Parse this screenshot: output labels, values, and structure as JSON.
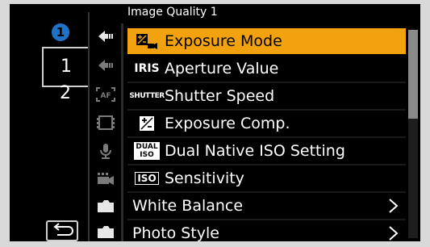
{
  "header": {
    "title": "Image Quality 1"
  },
  "left": {
    "mode_badge": "1",
    "tab1": "1",
    "tab2": "2"
  },
  "icons": [
    "camera-settings-icon",
    "camera-settings-icon-2",
    "af-icon",
    "film-icon",
    "microphone-icon",
    "video-camera-icon",
    "camera-body-icon",
    "camera-body-icon-2"
  ],
  "menu": {
    "items": [
      {
        "icon_text": "",
        "label": "Exposure Mode",
        "selected": true
      },
      {
        "icon_text": "IRIS",
        "label": "Aperture Value"
      },
      {
        "icon_text": "SHUTTER",
        "label": "Shutter Speed"
      },
      {
        "icon_text": "",
        "label": "Exposure Comp."
      },
      {
        "icon_text": "DUAL ISO",
        "label": "Dual Native ISO Setting"
      },
      {
        "icon_text": "ISO",
        "label": "Sensitivity"
      },
      {
        "icon_text": "",
        "label": "White Balance"
      },
      {
        "icon_text": "",
        "label": "Photo Style"
      }
    ]
  },
  "colors": {
    "accent": "#f2a20f",
    "badge": "#1e73c8"
  }
}
